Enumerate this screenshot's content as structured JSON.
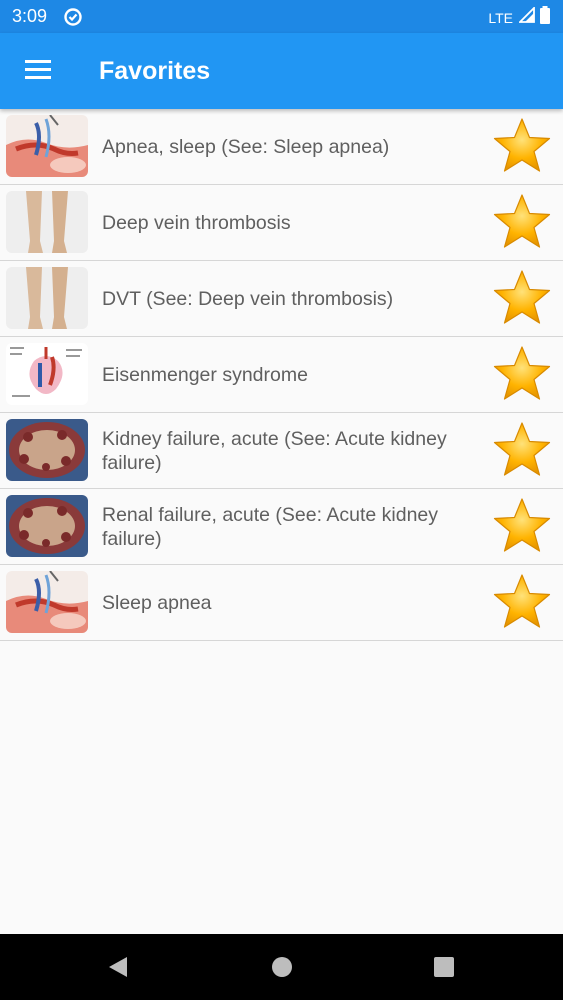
{
  "status_bar": {
    "time": "3:09",
    "network": "LTE"
  },
  "app_bar": {
    "title": "Favorites",
    "menu_icon": "hamburger-menu-icon"
  },
  "favorites": [
    {
      "label": "Apnea, sleep (See: Sleep apnea)",
      "thumbnail": "sleep-apnea"
    },
    {
      "label": "Deep vein thrombosis",
      "thumbnail": "legs"
    },
    {
      "label": "DVT (See: Deep vein thrombosis)",
      "thumbnail": "legs"
    },
    {
      "label": "Eisenmenger syndrome",
      "thumbnail": "heart-diagram"
    },
    {
      "label": "Kidney failure, acute (See: Acute kidney failure)",
      "thumbnail": "kidney"
    },
    {
      "label": "Renal failure, acute (See: Acute kidney failure)",
      "thumbnail": "kidney"
    },
    {
      "label": "Sleep apnea",
      "thumbnail": "sleep-apnea"
    }
  ],
  "colors": {
    "status_bar": "#1e88e5",
    "app_bar": "#2196f3",
    "star": "#ffb300"
  },
  "nav_bar": {
    "back_icon": "back-icon",
    "home_icon": "home-icon",
    "recents_icon": "recents-icon"
  }
}
